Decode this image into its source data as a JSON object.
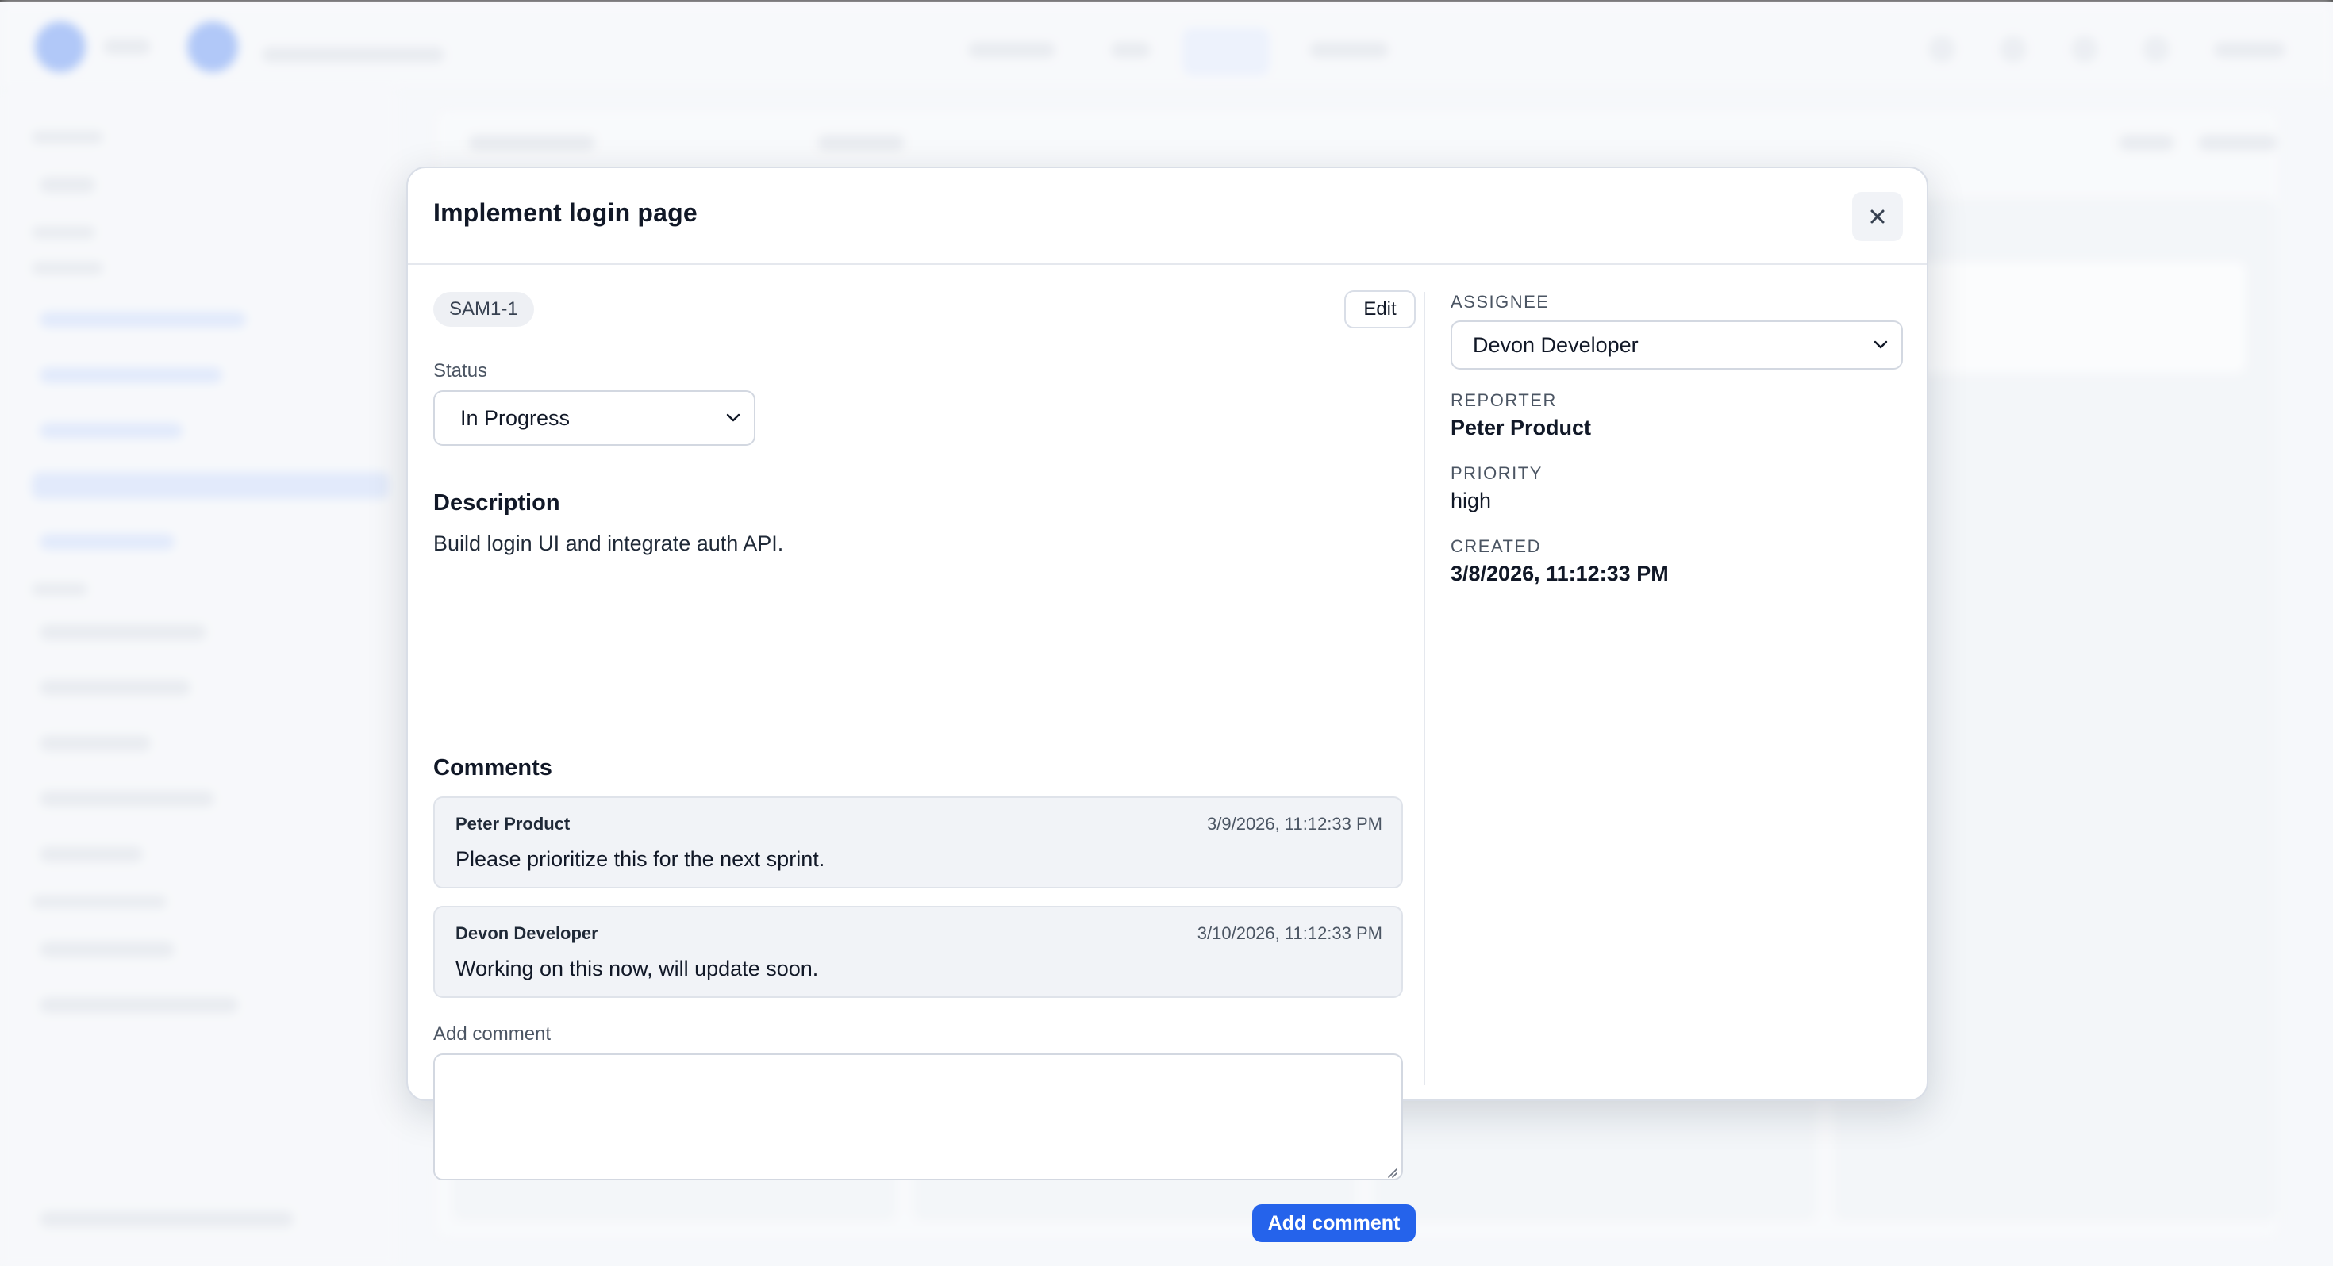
{
  "modal": {
    "title": "Implement login page",
    "close_icon": "close-icon",
    "issue_key": "SAM1-1",
    "edit_label": "Edit",
    "status": {
      "label": "Status",
      "selected": "In Progress"
    },
    "description": {
      "heading": "Description",
      "text": "Build login UI and integrate auth API."
    },
    "comments": {
      "heading": "Comments",
      "items": [
        {
          "author": "Peter Product",
          "time": "3/9/2026, 11:12:33 PM",
          "text": "Please prioritize this for the next sprint."
        },
        {
          "author": "Devon Developer",
          "time": "3/10/2026, 11:12:33 PM",
          "text": "Working on this now, will update soon."
        }
      ],
      "add_label": "Add comment",
      "input_value": "",
      "submit_label": "Add comment"
    },
    "details": {
      "assignee_label": "ASSIGNEE",
      "assignee_selected": "Devon Developer",
      "reporter_label": "REPORTER",
      "reporter_value": "Peter Product",
      "priority_label": "PRIORITY",
      "priority_value": "high",
      "created_label": "CREATED",
      "created_value": "3/8/2026, 11:12:33 PM"
    }
  },
  "colors": {
    "primary": "#2563eb",
    "modal_bg": "#ffffff",
    "comment_bg": "#f1f3f7",
    "badge_bg": "#eef0f4"
  }
}
